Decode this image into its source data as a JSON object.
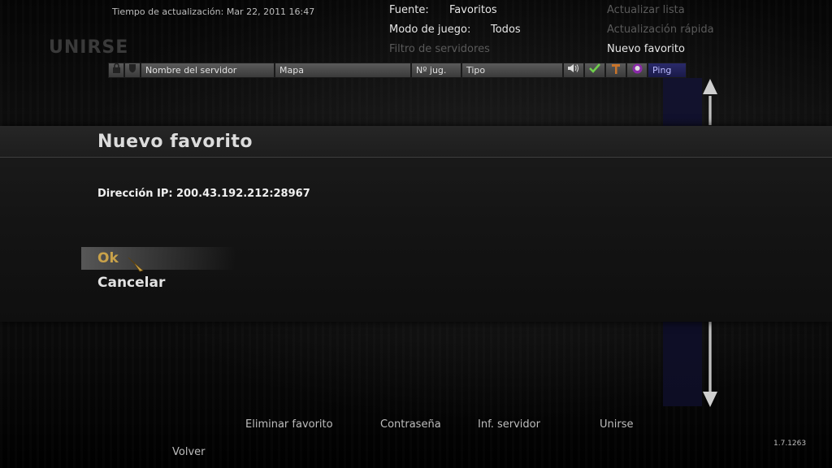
{
  "header": {
    "timestamp": "Tiempo de actualización: Mar 22, 2011   16:47",
    "page_heading": "UNIRSE",
    "source_label": "Fuente:",
    "source_value": "Favoritos",
    "gamemode_label": "Modo de juego:",
    "gamemode_value": "Todos",
    "server_filter": "Filtro de servidores",
    "refresh_list": "Actualizar lista",
    "quick_refresh": "Actualización rápida",
    "new_favorite": "Nuevo favorito"
  },
  "columns": {
    "server_name": "Nombre del servidor",
    "map": "Mapa",
    "players": "Nº jug.",
    "type": "Tipo",
    "ping": "Ping"
  },
  "dialog": {
    "title": "Nuevo favorito",
    "ip_label": "Dirección IP:",
    "ip_value": "200.43.192.212:28967",
    "ok_label": "Ok",
    "cancel_label": "Cancelar"
  },
  "footer": {
    "remove_favorite": "Eliminar favorito",
    "password": "Contraseña",
    "server_info": "Inf. servidor",
    "join": "Unirse",
    "back": "Volver",
    "version": "1.7.1263"
  },
  "colors": {
    "accent_gold": "#c9a24a",
    "ping_header": "#2a2a6a"
  }
}
